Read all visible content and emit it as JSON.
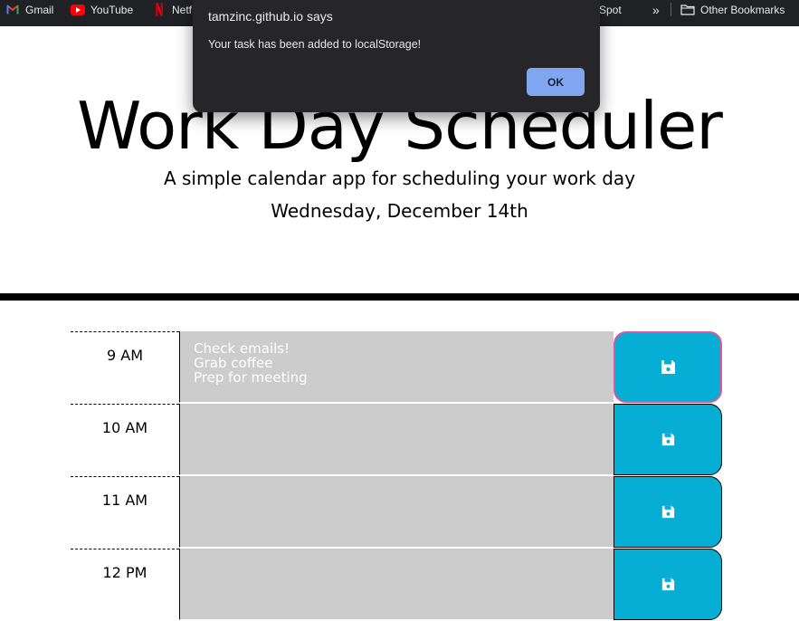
{
  "bookmarks": {
    "items": [
      {
        "label": "Gmail",
        "icon": "gmail-icon"
      },
      {
        "label": "YouTube",
        "icon": "youtube-icon"
      },
      {
        "label": "Netf",
        "icon": "netflix-icon"
      },
      {
        "label": "Spot",
        "icon": null
      }
    ],
    "more_icon": "double-chevron-icon",
    "more_label": "»",
    "other_label": "Other Bookmarks",
    "other_icon": "folder-icon"
  },
  "header": {
    "title": "Work Day Scheduler",
    "subtitle": "A simple calendar app for scheduling your work day",
    "current_day": "Wednesday, December 14th"
  },
  "schedule": {
    "rows": [
      {
        "hour": "9 AM",
        "description": "Check emails!\nGrab coffee\nPrep for meeting"
      },
      {
        "hour": "10 AM",
        "description": ""
      },
      {
        "hour": "11 AM",
        "description": ""
      },
      {
        "hour": "12 PM",
        "description": ""
      }
    ],
    "save_icon": "floppy-disk-icon"
  },
  "dialog": {
    "title": "tamzinc.github.io says",
    "message": "Your task has been added to localStorage!",
    "ok_label": "OK"
  },
  "colors": {
    "past": "#cccccc",
    "save_button": "#06aed5",
    "bookmarks_bar": "#202124",
    "dialog_bg": "#262628",
    "dialog_ok": "#7fa6ee"
  }
}
